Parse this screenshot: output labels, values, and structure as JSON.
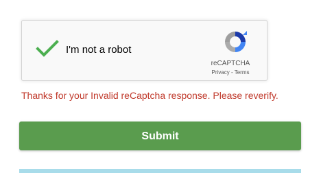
{
  "recaptcha": {
    "checkbox_label": "I'm not a robot",
    "brand": "reCAPTCHA",
    "privacy_link": "Privacy",
    "separator": "-",
    "terms_link": "Terms",
    "check_icon": "checkmark-icon",
    "logo_icon": "recaptcha-logo-icon"
  },
  "error_message": "Thanks for your Invalid reCaptcha response. Please reverify.",
  "submit": {
    "label": "Submit"
  },
  "colors": {
    "checkmark": "#4caf50",
    "error": "#c0392b",
    "submit_bg": "#5a9c4e",
    "bottom_bar": "#a8dcea"
  }
}
